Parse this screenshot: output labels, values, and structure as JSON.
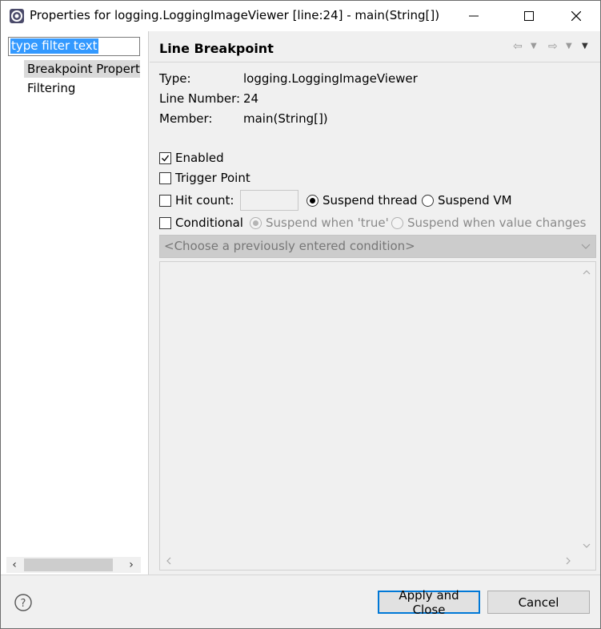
{
  "window": {
    "title": "Properties for logging.LoggingImageViewer [line:24] - main(String[])"
  },
  "sidebar": {
    "filter_text": "type filter text",
    "items": [
      {
        "label": "Breakpoint Properti",
        "selected": true
      },
      {
        "label": "Filtering",
        "selected": false
      }
    ]
  },
  "page": {
    "title": "Line Breakpoint",
    "info": [
      {
        "label": "Type:",
        "value": "logging.LoggingImageViewer"
      },
      {
        "label": "Line Number:",
        "value": "24"
      },
      {
        "label": "Member:",
        "value": "main(String[])"
      }
    ],
    "options": {
      "enabled": {
        "label": "Enabled",
        "checked": true
      },
      "trigger_point": {
        "label": "Trigger Point",
        "checked": false
      },
      "hit_count": {
        "label": "Hit count:",
        "checked": false,
        "value": ""
      },
      "suspend_thread": {
        "label": "Suspend thread",
        "selected": true
      },
      "suspend_vm": {
        "label": "Suspend VM",
        "selected": false
      },
      "conditional": {
        "label": "Conditional",
        "checked": false
      },
      "suspend_when_true": {
        "label": "Suspend when 'true'",
        "selected": true,
        "disabled": true
      },
      "suspend_when_changes": {
        "label": "Suspend when value changes",
        "selected": false,
        "disabled": true
      }
    },
    "condition_combo": "<Choose a previously entered condition>"
  },
  "buttons": {
    "apply_close": "Apply and Close",
    "cancel": "Cancel"
  },
  "colors": {
    "primary_border": "#0078d7",
    "selection": "#3399ff"
  }
}
